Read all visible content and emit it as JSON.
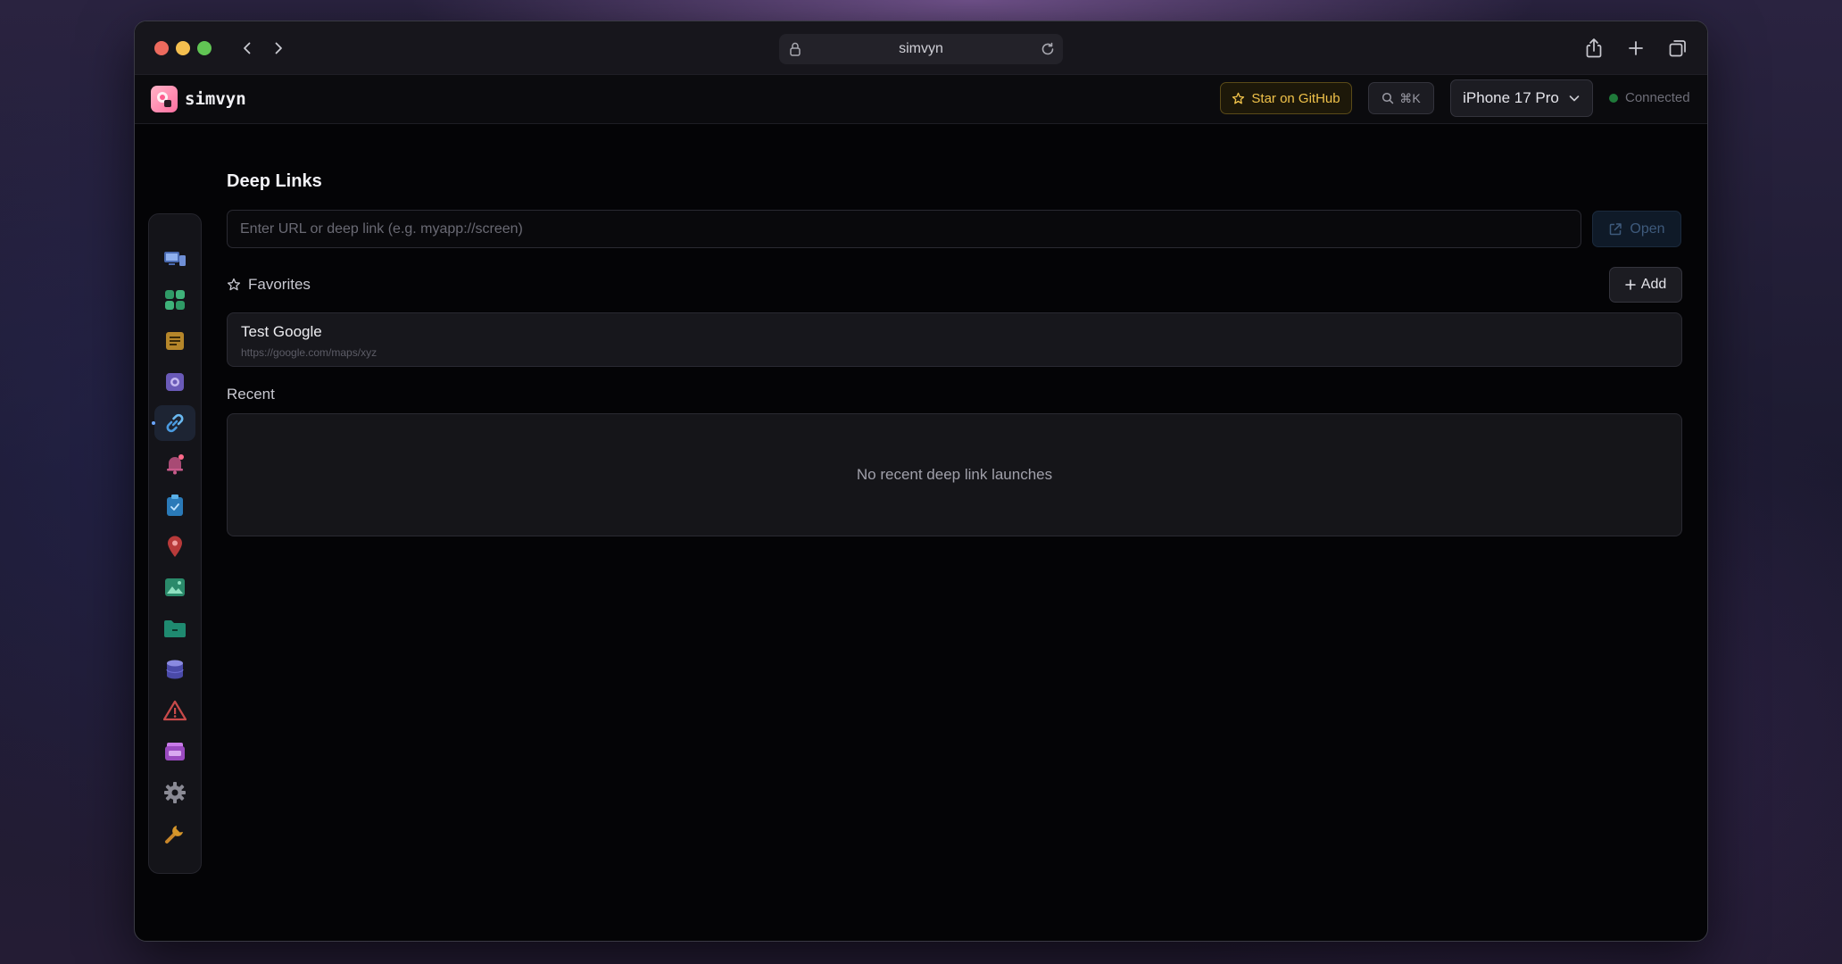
{
  "browser": {
    "url": "simvyn"
  },
  "header": {
    "app_name": "simvyn",
    "star_label": "Star on GitHub",
    "search_shortcut": "⌘K",
    "device": "iPhone 17 Pro",
    "status": "Connected"
  },
  "sidebar": {
    "items": [
      {
        "icon": "devices-icon",
        "color": "#6f8fd6"
      },
      {
        "icon": "apps-grid-icon",
        "color": "#3fb37a"
      },
      {
        "icon": "logs-icon",
        "color": "#d6a53a"
      },
      {
        "icon": "screenshot-icon",
        "color": "#8a7ad6"
      },
      {
        "icon": "link-icon",
        "color": "#4a9ae0",
        "active": true
      },
      {
        "icon": "notification-bell-icon",
        "color": "#d85a8a"
      },
      {
        "icon": "clipboard-icon",
        "color": "#3a9ad6"
      },
      {
        "icon": "location-pin-icon",
        "color": "#d64a4a"
      },
      {
        "icon": "media-image-icon",
        "color": "#3ab38a"
      },
      {
        "icon": "folder-icon",
        "color": "#2aa88a"
      },
      {
        "icon": "database-icon",
        "color": "#6a6ad6"
      },
      {
        "icon": "warning-icon",
        "color": "#d64a4a"
      },
      {
        "icon": "layers-icon",
        "color": "#b05ad6"
      },
      {
        "icon": "settings-gear-icon",
        "color": "#8a8a94"
      },
      {
        "icon": "wrench-icon",
        "color": "#d6962a"
      }
    ]
  },
  "main": {
    "title": "Deep Links",
    "input_placeholder": "Enter URL or deep link (e.g. myapp://screen)",
    "open_label": "Open",
    "favorites_label": "Favorites",
    "add_label": "Add",
    "favorites": [
      {
        "name": "Test Google",
        "url": "https://google.com/maps/xyz"
      }
    ],
    "recent_label": "Recent",
    "recent_empty": "No recent deep link launches"
  }
}
